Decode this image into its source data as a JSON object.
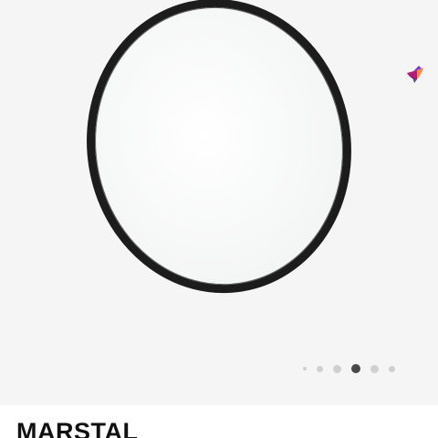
{
  "product": {
    "name": "MARSTAL",
    "image_icon": "round-mirror-image"
  },
  "badge": {
    "icon": "hummingbird-logo-icon",
    "colors": [
      "#b5197a",
      "#ff8a3d",
      "#7b3bd6"
    ]
  },
  "gallery": {
    "total_images": 6,
    "current_image": 4
  },
  "colors": {
    "background": "#f5f5f5",
    "info_background": "#ffffff",
    "frame": "#1c1c1c",
    "dot_active": "#484848",
    "dot_inactive": "#d0d0d0"
  }
}
